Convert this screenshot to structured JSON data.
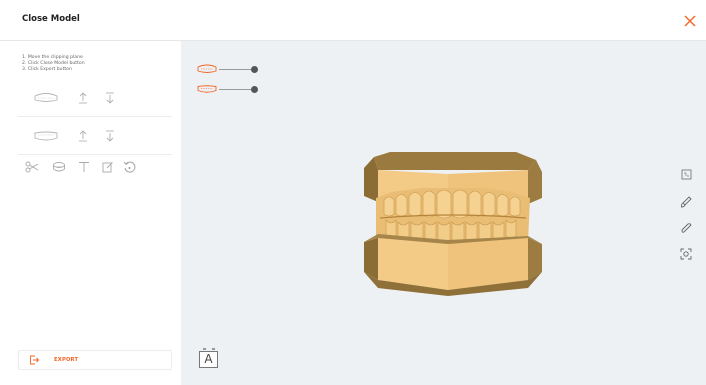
{
  "window": {
    "title": "Close Model"
  },
  "instructions": [
    "1. Move the clipping plane",
    "2. Click Close Model button",
    "3. Click Export button"
  ],
  "export": {
    "label": "EXPORT"
  },
  "viewport": {
    "label_letter": "A",
    "model_color": "#f3ca86",
    "accent_color": "#f26522"
  },
  "icons": {
    "close": "close-icon",
    "upper_jaw": "upper-jaw-icon",
    "lower_jaw": "lower-jaw-icon",
    "arrow_up": "arrow-up-icon",
    "arrow_down": "arrow-down-icon",
    "scissors": "scissors-icon",
    "base": "model-base-icon",
    "text": "text-icon",
    "edit": "edit-icon",
    "undo": "undo-icon",
    "view_box": "view-box-icon",
    "brush": "brush-icon",
    "measure": "measure-icon",
    "screenshot": "screenshot-icon"
  }
}
